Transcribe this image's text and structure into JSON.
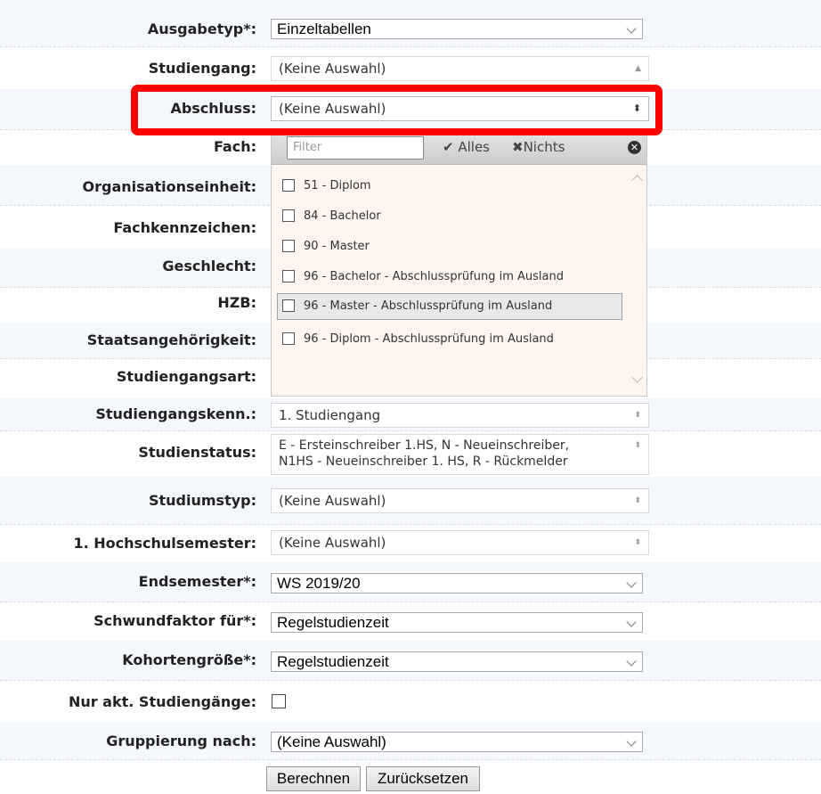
{
  "form": {
    "ausgabetyp": {
      "label": "Ausgabetyp*:",
      "value": "Einzeltabellen"
    },
    "studiengang": {
      "label": "Studiengang:",
      "value": "(Keine Auswahl)"
    },
    "abschluss": {
      "label": "Abschluss:",
      "value": "(Keine Auswahl)"
    },
    "fach": {
      "label": "Fach:"
    },
    "organisationseinheit": {
      "label": "Organisationseinheit:"
    },
    "fachkennzeichen": {
      "label": "Fachkennzeichen:"
    },
    "geschlecht": {
      "label": "Geschlecht:"
    },
    "hzb": {
      "label": "HZB:"
    },
    "staatsangehoerigkeit": {
      "label": "Staatsangehörigkeit:"
    },
    "studiengangsart": {
      "label": "Studiengangsart:"
    },
    "studiengangskenn": {
      "label": "Studiengangskenn.:",
      "value": "1. Studiengang"
    },
    "studienstatus": {
      "label": "Studienstatus:",
      "value_line1": "E - Ersteinschreiber 1.HS, N - Neueinschreiber,",
      "value_line2": "N1HS - Neueinschreiber 1. HS, R - Rückmelder"
    },
    "studiumstyp": {
      "label": "Studiumstyp:",
      "value": "(Keine Auswahl)"
    },
    "hochschulsemester": {
      "label": "1. Hochschulsemester:",
      "value": "(Keine Auswahl)"
    },
    "endsemester": {
      "label": "Endsemester*:",
      "value": "WS 2019/20"
    },
    "schwundfaktor": {
      "label": "Schwundfaktor für*:",
      "value": "Regelstudienzeit"
    },
    "kohortengroesse": {
      "label": "Kohortengröße*:",
      "value": "Regelstudienzeit"
    },
    "nur_akt": {
      "label": "Nur akt. Studiengänge:",
      "checked": false
    },
    "gruppierung": {
      "label": "Gruppierung nach:",
      "value": "(Keine Auswahl)"
    }
  },
  "dropdown": {
    "filter_placeholder": "Filter",
    "all_label": "Alles",
    "none_label": "Nichts",
    "options": [
      {
        "label": "51 - Diplom",
        "checked": false
      },
      {
        "label": "84 - Bachelor",
        "checked": false
      },
      {
        "label": "90 - Master",
        "checked": false
      },
      {
        "label": "96 - Bachelor - Abschlussprüfung im Ausland",
        "checked": false
      },
      {
        "label": "96 - Master - Abschlussprüfung im Ausland",
        "checked": false,
        "highlighted": true
      },
      {
        "label": "96 - Diplom - Abschlussprüfung im Ausland",
        "checked": false
      }
    ]
  },
  "buttons": {
    "berechnen": "Berechnen",
    "zuruecksetzen": "Zurücksetzen"
  },
  "colors": {
    "highlight": "#ff0000",
    "dropdown_bg": "#fdf5ee",
    "row_shade": "#f4f7fb"
  }
}
